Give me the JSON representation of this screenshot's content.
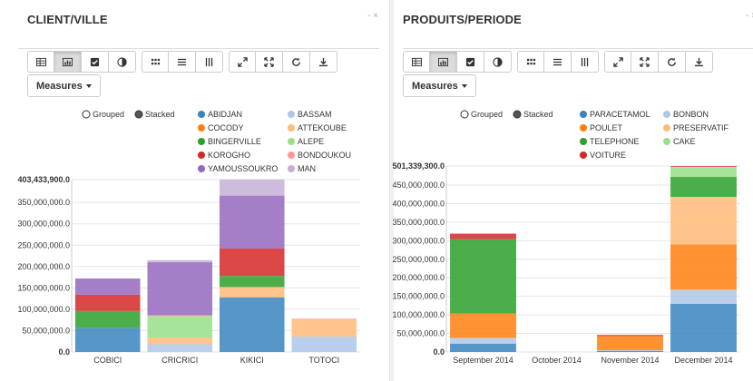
{
  "panels": [
    {
      "title": "CLIENT/VILLE",
      "controls": "- ×",
      "measures_label": "Measures",
      "chart_data": {
        "type": "bar",
        "stacked": true,
        "categories": [
          "COBICI",
          "CRICRICI",
          "KIKICI",
          "TOTOCI"
        ],
        "yticks": [
          0,
          50000000,
          100000000,
          150000000,
          200000000,
          250000000,
          300000000,
          350000000,
          403433900
        ],
        "ytick_labels": [
          "0.0",
          "50,000,000.0",
          "100,000,000.0",
          "150,000,000.0",
          "200,000,000.0",
          "250,000,000.0",
          "300,000,000.0",
          "350,000,000.0",
          "403,433,900.0"
        ],
        "ylim": [
          0,
          403433900
        ],
        "legend_modes": [
          "Grouped",
          "Stacked"
        ],
        "legend_mode_selected": "Stacked",
        "series": [
          {
            "name": "ABIDJAN",
            "color": "#3a84c0",
            "values": [
              56000000,
              0,
              128000000,
              0
            ]
          },
          {
            "name": "BASSAM",
            "color": "#aec7e8",
            "values": [
              0,
              18000000,
              0,
              36000000
            ]
          },
          {
            "name": "COCODY",
            "color": "#ff7f0e",
            "values": [
              0,
              0,
              0,
              0
            ]
          },
          {
            "name": "ATTEKOUBE",
            "color": "#ffbb78",
            "values": [
              0,
              16000000,
              24000000,
              40000000
            ]
          },
          {
            "name": "BINGERVILLE",
            "color": "#2ca02c",
            "values": [
              40000000,
              0,
              26000000,
              0
            ]
          },
          {
            "name": "ALEPE",
            "color": "#98df8a",
            "values": [
              0,
              50000000,
              0,
              0
            ]
          },
          {
            "name": "KOROGHO",
            "color": "#d62728",
            "values": [
              38000000,
              0,
              64000000,
              0
            ]
          },
          {
            "name": "BONDOUKOU",
            "color": "#ff9896",
            "values": [
              0,
              2000000,
              0,
              2000000
            ]
          },
          {
            "name": "YAMOUSSOUKRO",
            "color": "#9467bd",
            "values": [
              38000000,
              124000000,
              124000000,
              0
            ]
          },
          {
            "name": "MAN",
            "color": "#c5b0d5",
            "values": [
              0,
              5000000,
              38000000,
              0
            ]
          }
        ]
      }
    },
    {
      "title": "PRODUITS/PERIODE",
      "controls": "- ×",
      "measures_label": "Measures",
      "chart_data": {
        "type": "bar",
        "stacked": true,
        "categories": [
          "September 2014",
          "October 2014",
          "November 2014",
          "December 2014"
        ],
        "yticks": [
          0,
          50000000,
          100000000,
          150000000,
          200000000,
          250000000,
          300000000,
          350000000,
          400000000,
          450000000,
          501339300
        ],
        "ytick_labels": [
          "0.0",
          "50,000,000.0",
          "100,000,000.0",
          "150,000,000.0",
          "200,000,000.0",
          "250,000,000.0",
          "300,000,000.0",
          "350,000,000.0",
          "400,000,000.0",
          "450,000,000.0",
          "501,339,300.0"
        ],
        "ylim": [
          0,
          501339300
        ],
        "legend_modes": [
          "Grouped",
          "Stacked"
        ],
        "legend_mode_selected": "Stacked",
        "series": [
          {
            "name": "PARACETAMOL",
            "color": "#3a84c0",
            "values": [
              22000000,
              0,
              3000000,
              130000000
            ]
          },
          {
            "name": "BONBON",
            "color": "#aec7e8",
            "values": [
              16000000,
              0,
              2000000,
              38000000
            ]
          },
          {
            "name": "POULET",
            "color": "#ff7f0e",
            "values": [
              66000000,
              0,
              38000000,
              122000000
            ]
          },
          {
            "name": "PRESERVATIF",
            "color": "#ffbb78",
            "values": [
              0,
              0,
              0,
              128000000
            ]
          },
          {
            "name": "TELEPHONE",
            "color": "#2ca02c",
            "values": [
              200000000,
              0,
              0,
              54000000
            ]
          },
          {
            "name": "CAKE",
            "color": "#98df8a",
            "values": [
              0,
              0,
              0,
              27000000
            ]
          },
          {
            "name": "VOITURE",
            "color": "#d62728",
            "values": [
              15000000,
              0,
              3000000,
              2000000
            ]
          }
        ]
      }
    }
  ]
}
